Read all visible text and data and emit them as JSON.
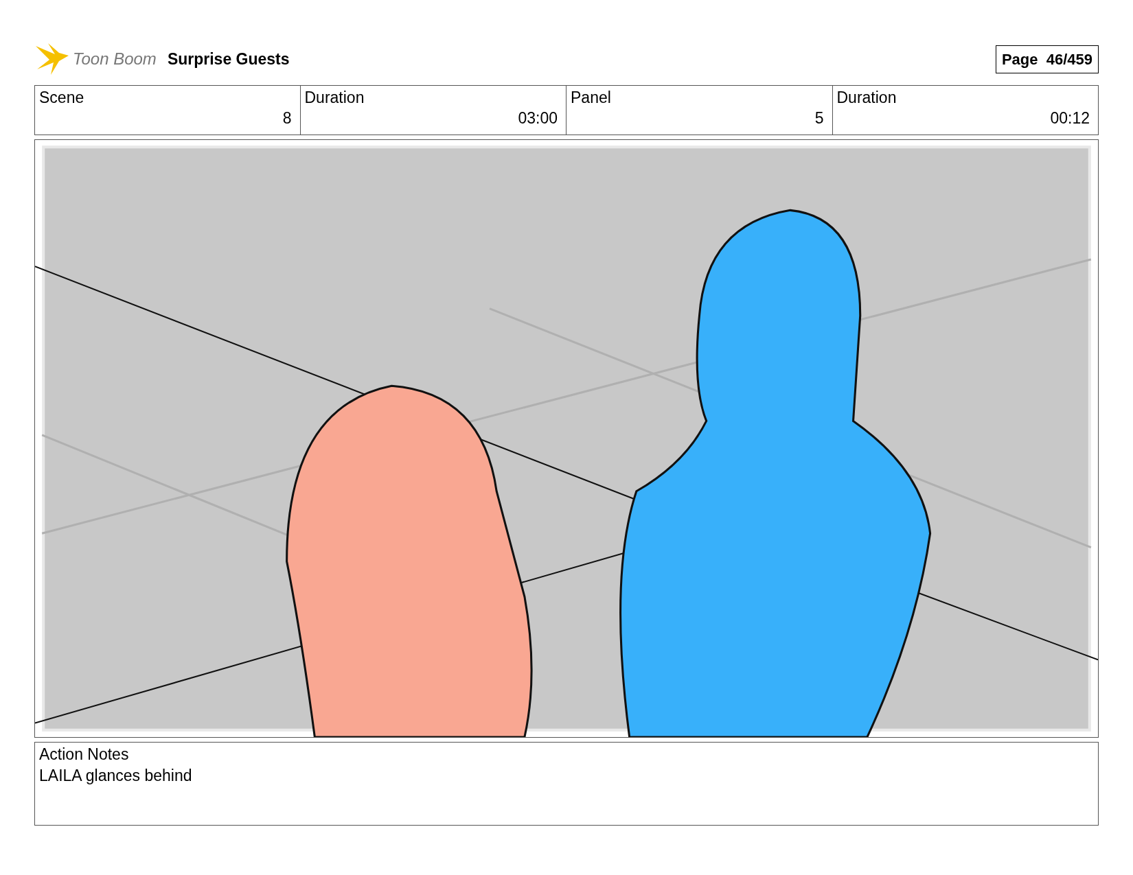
{
  "header": {
    "logo_text": "Toon Boom",
    "title": "Surprise Guests",
    "page": "Page  46/459"
  },
  "info_table": {
    "columns": [
      "Scene",
      "Duration",
      "Panel",
      "Duration"
    ],
    "row": [
      "8",
      "03:00",
      "5",
      "00:12"
    ]
  },
  "notes": {
    "label": "Action Notes",
    "text": "LAILA glances behind"
  }
}
